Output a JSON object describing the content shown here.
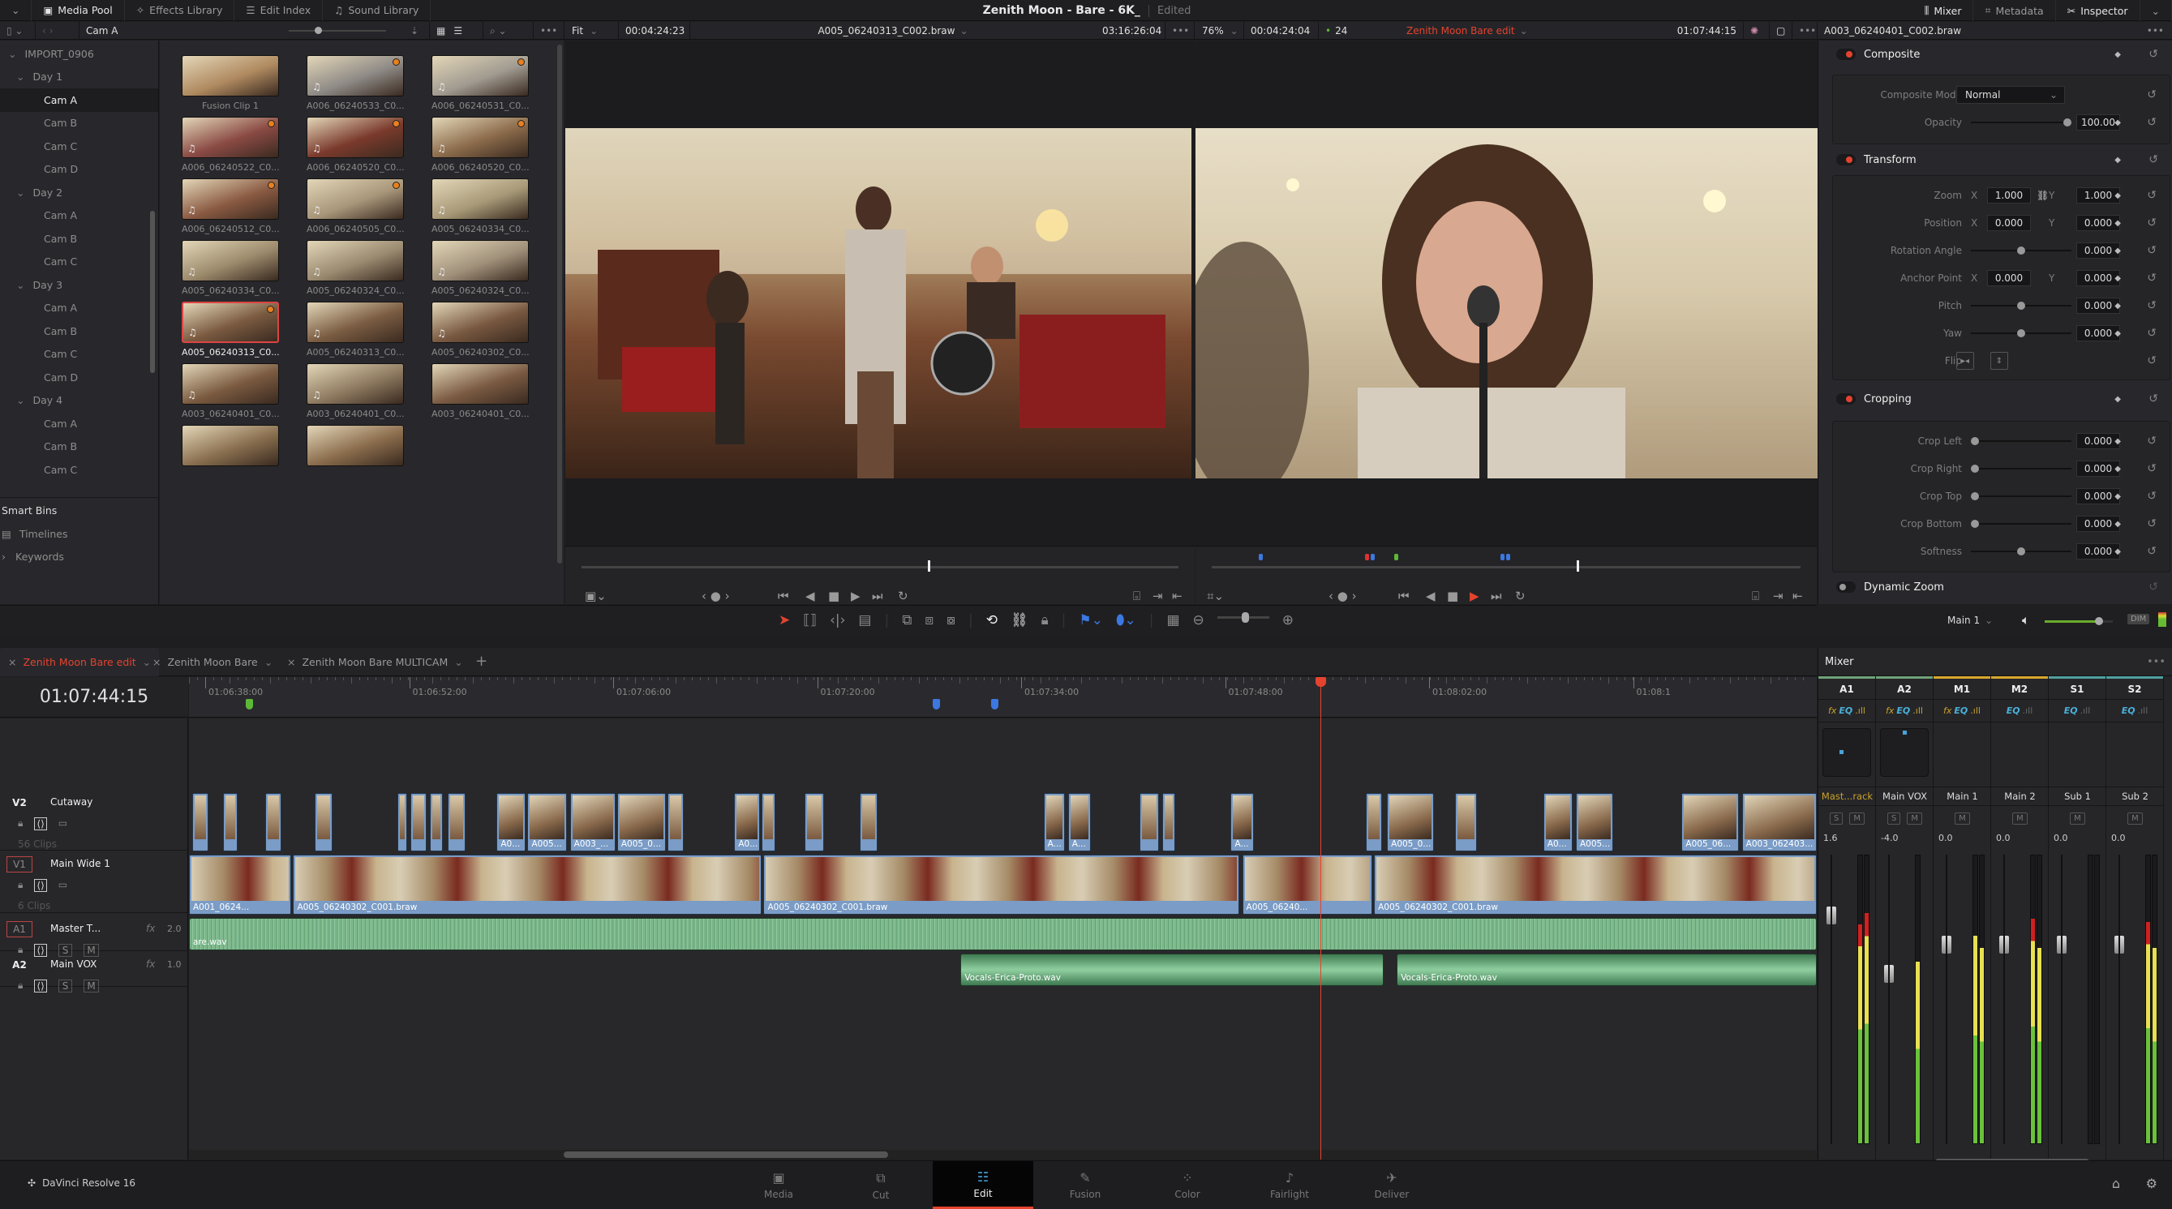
{
  "topbar": {
    "items": [
      {
        "label": "Media Pool",
        "icon": "media-pool-icon",
        "active": true
      },
      {
        "label": "Effects Library",
        "icon": "effects-wand-icon",
        "active": false
      },
      {
        "label": "Edit Index",
        "icon": "list-icon",
        "active": false
      },
      {
        "label": "Sound Library",
        "icon": "music-list-icon",
        "active": false
      }
    ],
    "project_title": "Zenith Moon - Bare - 6K_",
    "project_status": "Edited",
    "right_items": [
      {
        "label": "Mixer",
        "icon": "mixer-icon",
        "active": true
      },
      {
        "label": "Metadata",
        "icon": "metadata-icon",
        "active": false
      },
      {
        "label": "Inspector",
        "icon": "inspector-icon",
        "active": true
      }
    ]
  },
  "media_pool": {
    "current_bin": "Cam A",
    "bins": [
      {
        "label": "IMPORT_0906",
        "level": 0,
        "expanded": true
      },
      {
        "label": "Day 1",
        "level": 1,
        "expanded": true
      },
      {
        "label": "Cam A",
        "level": 2,
        "selected": true
      },
      {
        "label": "Cam B",
        "level": 2
      },
      {
        "label": "Cam C",
        "level": 2
      },
      {
        "label": "Cam D",
        "level": 2
      },
      {
        "label": "Day 2",
        "level": 1,
        "expanded": true
      },
      {
        "label": "Cam A",
        "level": 2
      },
      {
        "label": "Cam B",
        "level": 2
      },
      {
        "label": "Cam C",
        "level": 2
      },
      {
        "label": "Day 3",
        "level": 1,
        "expanded": true
      },
      {
        "label": "Cam A",
        "level": 2
      },
      {
        "label": "Cam B",
        "level": 2
      },
      {
        "label": "Cam C",
        "level": 2
      },
      {
        "label": "Cam D",
        "level": 2
      },
      {
        "label": "Day 4",
        "level": 1,
        "expanded": true
      },
      {
        "label": "Cam A",
        "level": 2
      },
      {
        "label": "Cam B",
        "level": 2
      },
      {
        "label": "Cam C",
        "level": 2
      }
    ],
    "smart_bins_label": "Smart Bins",
    "smart_bins": [
      "Timelines",
      "Keywords"
    ],
    "clips": [
      {
        "name": "Fusion Clip 1",
        "audio": false,
        "flag": false,
        "selected": false,
        "tone": "#b08a60"
      },
      {
        "name": "A006_06240533_C0...",
        "audio": true,
        "flag": true,
        "selected": false,
        "tone": "#8e8a86"
      },
      {
        "name": "A006_06240531_C0...",
        "audio": true,
        "flag": true,
        "selected": false,
        "tone": "#a09a90"
      },
      {
        "name": "A006_06240522_C0...",
        "audio": true,
        "flag": true,
        "selected": false,
        "tone": "#8a4a44"
      },
      {
        "name": "A006_06240520_C0...",
        "audio": true,
        "flag": true,
        "selected": false,
        "tone": "#7a3a2c"
      },
      {
        "name": "A006_06240520_C0...",
        "audio": true,
        "flag": true,
        "selected": false,
        "tone": "#8a6a4a"
      },
      {
        "name": "A006_06240512_C0...",
        "audio": true,
        "flag": true,
        "selected": false,
        "tone": "#8a5a42"
      },
      {
        "name": "A006_06240505_C0...",
        "audio": true,
        "flag": true,
        "selected": false,
        "tone": "#a8967a"
      },
      {
        "name": "A005_06240334_C0...",
        "audio": true,
        "flag": false,
        "selected": false,
        "tone": "#a89a78"
      },
      {
        "name": "A005_06240334_C0...",
        "audio": true,
        "flag": false,
        "selected": false,
        "tone": "#9c8a6c"
      },
      {
        "name": "A005_06240324_C0...",
        "audio": true,
        "flag": false,
        "selected": false,
        "tone": "#9a8a70"
      },
      {
        "name": "A005_06240324_C0...",
        "audio": true,
        "flag": false,
        "selected": false,
        "tone": "#a0907a"
      },
      {
        "name": "A005_06240313_C0...",
        "audio": true,
        "flag": true,
        "selected": true,
        "tone": "#7a5a40"
      },
      {
        "name": "A005_06240313_C0...",
        "audio": true,
        "flag": false,
        "selected": false,
        "tone": "#7a5c42"
      },
      {
        "name": "A005_06240302_C0...",
        "audio": true,
        "flag": false,
        "selected": false,
        "tone": "#785840"
      },
      {
        "name": "A003_06240401_C0...",
        "audio": true,
        "flag": false,
        "selected": false,
        "tone": "#7a5a40"
      },
      {
        "name": "A003_06240401_C0...",
        "audio": true,
        "flag": false,
        "selected": false,
        "tone": "#8e7a60"
      },
      {
        "name": "A003_06240401_C0...",
        "audio": false,
        "flag": false,
        "selected": false,
        "tone": "#7a5a42"
      },
      {
        "name": "",
        "audio": false,
        "flag": false,
        "selected": false,
        "tone": "#8a7050"
      },
      {
        "name": "",
        "audio": false,
        "flag": false,
        "selected": false,
        "tone": "#8a6c4c"
      }
    ]
  },
  "source_viewer": {
    "zoom": "Fit",
    "timecode": "00:04:24:23",
    "clip_name": "A005_06240313_C002.braw",
    "duration": "03:16:26:04",
    "scrub_position": 0.58
  },
  "timeline_viewer": {
    "zoom": "76%",
    "timecode": "00:04:24:04",
    "fps": "24",
    "timeline_name": "Zenith Moon Bare edit",
    "current_timecode": "01:07:44:15",
    "scrub_position": 0.62
  },
  "inspector": {
    "clip_name": "A003_06240401_C002.braw",
    "composite": {
      "title": "Composite",
      "mode_label": "Composite Mode",
      "mode_value": "Normal",
      "opacity_label": "Opacity",
      "opacity_value": "100.00",
      "opacity_fraction": 1.0
    },
    "transform": {
      "title": "Transform",
      "zoom_label": "Zoom",
      "zoom_x": "1.000",
      "zoom_y": "1.000",
      "position_label": "Position",
      "position_x": "0.000",
      "position_y": "0.000",
      "rotation_label": "Rotation Angle",
      "rotation_value": "0.000",
      "anchor_label": "Anchor Point",
      "anchor_x": "0.000",
      "anchor_y": "0.000",
      "pitch_label": "Pitch",
      "pitch_value": "0.000",
      "yaw_label": "Yaw",
      "yaw_value": "0.000",
      "flip_label": "Flip",
      "x_label": "X",
      "y_label": "Y"
    },
    "cropping": {
      "title": "Cropping",
      "rows": [
        {
          "label": "Crop Left",
          "value": "0.000",
          "fraction": 0.0
        },
        {
          "label": "Crop Right",
          "value": "0.000",
          "fraction": 0.0
        },
        {
          "label": "Crop Top",
          "value": "0.000",
          "fraction": 0.0
        },
        {
          "label": "Crop Bottom",
          "value": "0.000",
          "fraction": 0.0
        },
        {
          "label": "Softness",
          "value": "0.000",
          "fraction": 0.5
        }
      ]
    },
    "dynamic_zoom": {
      "title": "Dynamic Zoom",
      "enabled": false
    }
  },
  "audio_control": {
    "output": "Main 1",
    "dim_label": "DIM",
    "volume_fraction": 0.8
  },
  "timeline": {
    "tabs": [
      {
        "label": "Zenith Moon Bare edit",
        "active": true
      },
      {
        "label": "Zenith Moon Bare",
        "active": false
      },
      {
        "label": "Zenith Moon Bare MULTICAM",
        "active": false
      }
    ],
    "current_timecode": "01:07:44:15",
    "ruler_ticks": [
      "01:06:38:00",
      "01:06:52:00",
      "01:07:06:00",
      "01:07:20:00",
      "01:07:34:00",
      "01:07:48:00",
      "01:08:02:00",
      "01:08:1"
    ],
    "markers": [
      {
        "pos": 0.035,
        "color": "#5cb836"
      },
      {
        "pos": 0.457,
        "color": "#3c78e0"
      },
      {
        "pos": 0.493,
        "color": "#3c78e0"
      }
    ],
    "playhead_fraction": 0.695,
    "tracks": [
      {
        "id": "V2",
        "name": "Cutaway",
        "clips_count": "56 Clips",
        "kind": "video",
        "armed": false
      },
      {
        "id": "V1",
        "name": "Main Wide 1",
        "clips_count": "6 Clips",
        "kind": "video",
        "armed": true
      },
      {
        "id": "A1",
        "name": "Master T...",
        "fx": "fx",
        "level": "2.0",
        "kind": "audio",
        "armed": true
      },
      {
        "id": "A2",
        "name": "Main VOX",
        "fx": "fx",
        "level": "1.0",
        "kind": "audio",
        "armed": false
      }
    ],
    "v2_clips": [
      {
        "s": 0.002,
        "e": 0.012,
        "l": ""
      },
      {
        "s": 0.021,
        "e": 0.03,
        "l": ""
      },
      {
        "s": 0.047,
        "e": 0.057,
        "l": ""
      },
      {
        "s": 0.077,
        "e": 0.088,
        "l": ""
      },
      {
        "s": 0.128,
        "e": 0.134,
        "l": ""
      },
      {
        "s": 0.136,
        "e": 0.146,
        "l": ""
      },
      {
        "s": 0.148,
        "e": 0.156,
        "l": ""
      },
      {
        "s": 0.159,
        "e": 0.17,
        "l": ""
      },
      {
        "s": 0.189,
        "e": 0.207,
        "l": "A0..."
      },
      {
        "s": 0.208,
        "e": 0.232,
        "l": "A005..."
      },
      {
        "s": 0.234,
        "e": 0.262,
        "l": "A003_..."
      },
      {
        "s": 0.263,
        "e": 0.293,
        "l": "A005_0..."
      },
      {
        "s": 0.294,
        "e": 0.304,
        "l": ""
      },
      {
        "s": 0.335,
        "e": 0.351,
        "l": "A0..."
      },
      {
        "s": 0.352,
        "e": 0.36,
        "l": ""
      },
      {
        "s": 0.378,
        "e": 0.39,
        "l": ""
      },
      {
        "s": 0.412,
        "e": 0.423,
        "l": ""
      },
      {
        "s": 0.525,
        "e": 0.538,
        "l": "A..."
      },
      {
        "s": 0.54,
        "e": 0.554,
        "l": "A..."
      },
      {
        "s": 0.584,
        "e": 0.596,
        "l": ""
      },
      {
        "s": 0.598,
        "e": 0.606,
        "l": ""
      },
      {
        "s": 0.64,
        "e": 0.654,
        "l": "A..."
      },
      {
        "s": 0.723,
        "e": 0.733,
        "l": ""
      },
      {
        "s": 0.736,
        "e": 0.765,
        "l": "A005_0..."
      },
      {
        "s": 0.778,
        "e": 0.791,
        "l": ""
      },
      {
        "s": 0.832,
        "e": 0.85,
        "l": "A0..."
      },
      {
        "s": 0.852,
        "e": 0.875,
        "l": "A005..."
      },
      {
        "s": 0.917,
        "e": 0.952,
        "l": "A005_06..."
      },
      {
        "s": 0.954,
        "e": 1.0,
        "l": "A003_062403..."
      }
    ],
    "v1_clips": [
      {
        "s": 0.0,
        "e": 0.063,
        "l": "A001_0624..."
      },
      {
        "s": 0.064,
        "e": 0.352,
        "l": "A005_06240302_C001.braw"
      },
      {
        "s": 0.353,
        "e": 0.645,
        "l": "A005_06240302_C001.braw"
      },
      {
        "s": 0.647,
        "e": 0.727,
        "l": "A005_06240..."
      },
      {
        "s": 0.728,
        "e": 1.0,
        "l": "A005_06240302_C001.braw"
      }
    ],
    "a1_clips": [
      {
        "s": 0.0,
        "e": 1.0,
        "l": "are.wav"
      }
    ],
    "a2_clips": [
      {
        "s": 0.474,
        "e": 0.734,
        "l": "Vocals-Erica-Proto.wav"
      },
      {
        "s": 0.742,
        "e": 1.0,
        "l": "Vocals-Erica-Proto.wav"
      }
    ]
  },
  "mixer": {
    "title": "Mixer",
    "channels": [
      {
        "id": "A1",
        "name": "Mast...rack",
        "level": "1.6",
        "color": "#6fa37a",
        "fx": true,
        "eq": true,
        "solo": true,
        "fader": 0.82,
        "meters": [
          0.76,
          0.8
        ]
      },
      {
        "id": "A2",
        "name": "Main VOX",
        "level": "-4.0",
        "color": "#6fa37a",
        "fx": true,
        "eq": true,
        "solo": true,
        "fader": 0.62,
        "meters": [
          0.63
        ]
      },
      {
        "id": "M1",
        "name": "Main 1",
        "level": "0.0",
        "color": "#d9a82c",
        "fx": true,
        "eq": true,
        "solo": false,
        "fader": 0.72,
        "meters": [
          0.72,
          0.68
        ]
      },
      {
        "id": "M2",
        "name": "Main 2",
        "level": "0.0",
        "color": "#d9a82c",
        "fx": false,
        "eq": true,
        "solo": false,
        "fader": 0.72,
        "meters": [
          0.78,
          0.68
        ]
      },
      {
        "id": "S1",
        "name": "Sub 1",
        "level": "0.0",
        "color": "#4fa0a0",
        "fx": false,
        "eq": true,
        "solo": false,
        "fader": 0.72,
        "meters": [
          0.0,
          0.0
        ]
      },
      {
        "id": "S2",
        "name": "Sub 2",
        "level": "0.0",
        "color": "#4fa0a0",
        "fx": false,
        "eq": true,
        "solo": false,
        "fader": 0.72,
        "meters": [
          0.77,
          0.68
        ]
      }
    ],
    "solo_label": "S",
    "mute_label": "M"
  },
  "pages": [
    {
      "label": "Media",
      "icon": "media-page-icon",
      "active": false
    },
    {
      "label": "Cut",
      "icon": "cut-page-icon",
      "active": false
    },
    {
      "label": "Edit",
      "icon": "edit-page-icon",
      "active": true
    },
    {
      "label": "Fusion",
      "icon": "fusion-page-icon",
      "active": false
    },
    {
      "label": "Color",
      "icon": "color-page-icon",
      "active": false
    },
    {
      "label": "Fairlight",
      "icon": "fairlight-page-icon",
      "active": false
    },
    {
      "label": "Deliver",
      "icon": "deliver-page-icon",
      "active": false
    }
  ],
  "app_name": "DaVinci Resolve 16"
}
